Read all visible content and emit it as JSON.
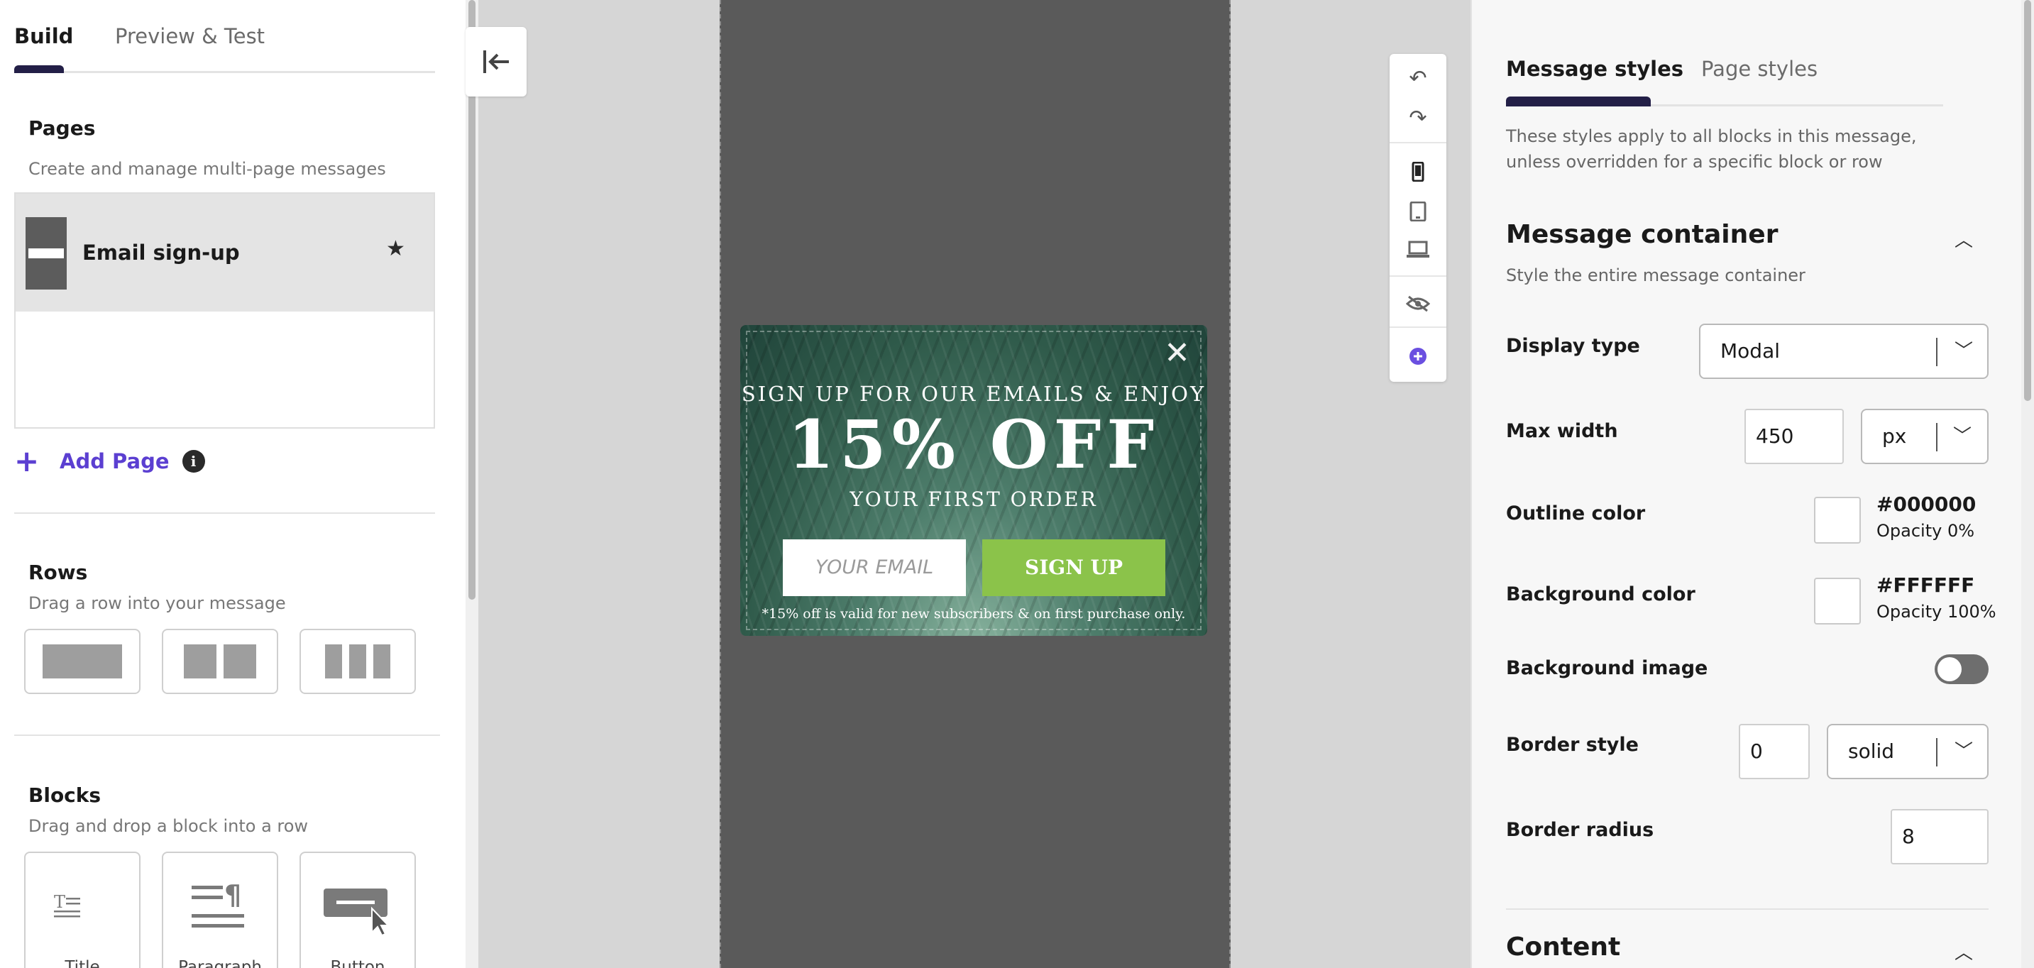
{
  "left_panel": {
    "tabs": [
      "Build",
      "Preview & Test"
    ],
    "pages": {
      "title": "Pages",
      "subtitle": "Create and manage multi-page messages",
      "items": [
        {
          "name": "Email sign-up"
        }
      ],
      "add_page_label": "Add Page"
    },
    "rows": {
      "title": "Rows",
      "subtitle": "Drag a row into your message"
    },
    "blocks": {
      "title": "Blocks",
      "subtitle": "Drag and drop a block into a row",
      "items": [
        "Title",
        "Paragraph",
        "Button"
      ]
    }
  },
  "canvas": {
    "modal": {
      "line1": "SIGN UP FOR OUR EMAILS & ENJOY",
      "headline": "15% OFF",
      "line3": "YOUR FIRST ORDER",
      "email_placeholder": "YOUR EMAIL",
      "button_label": "SIGN UP",
      "fine_print": "*15% off is valid for new subscribers & on first purchase only."
    },
    "toolbar_icons": [
      "undo-icon",
      "redo-icon",
      "mobile-icon",
      "tablet-icon",
      "desktop-icon",
      "hide-icon",
      "add-icon"
    ]
  },
  "right_panel": {
    "tabs": [
      "Message styles",
      "Page styles"
    ],
    "description": "These styles apply to all blocks in this message, unless overridden for a specific block or row",
    "message_container": {
      "title": "Message container",
      "subtitle": "Style the entire message container",
      "display_type": {
        "label": "Display type",
        "value": "Modal"
      },
      "max_width": {
        "label": "Max width",
        "value": "450",
        "unit": "px"
      },
      "outline_color": {
        "label": "Outline color",
        "hex": "#000000",
        "opacity": "Opacity 0%"
      },
      "background_color": {
        "label": "Background color",
        "hex": "#FFFFFF",
        "opacity": "Opacity 100%"
      },
      "background_image": {
        "label": "Background image",
        "enabled": false
      },
      "border_style": {
        "label": "Border style",
        "width": "0",
        "style": "solid"
      },
      "border_radius": {
        "label": "Border radius",
        "value": "8"
      }
    },
    "content": {
      "title": "Content"
    }
  },
  "colors": {
    "accent": "#5b3fd1",
    "tab_underline": "#231f47",
    "signup_button": "#8bc34a"
  }
}
